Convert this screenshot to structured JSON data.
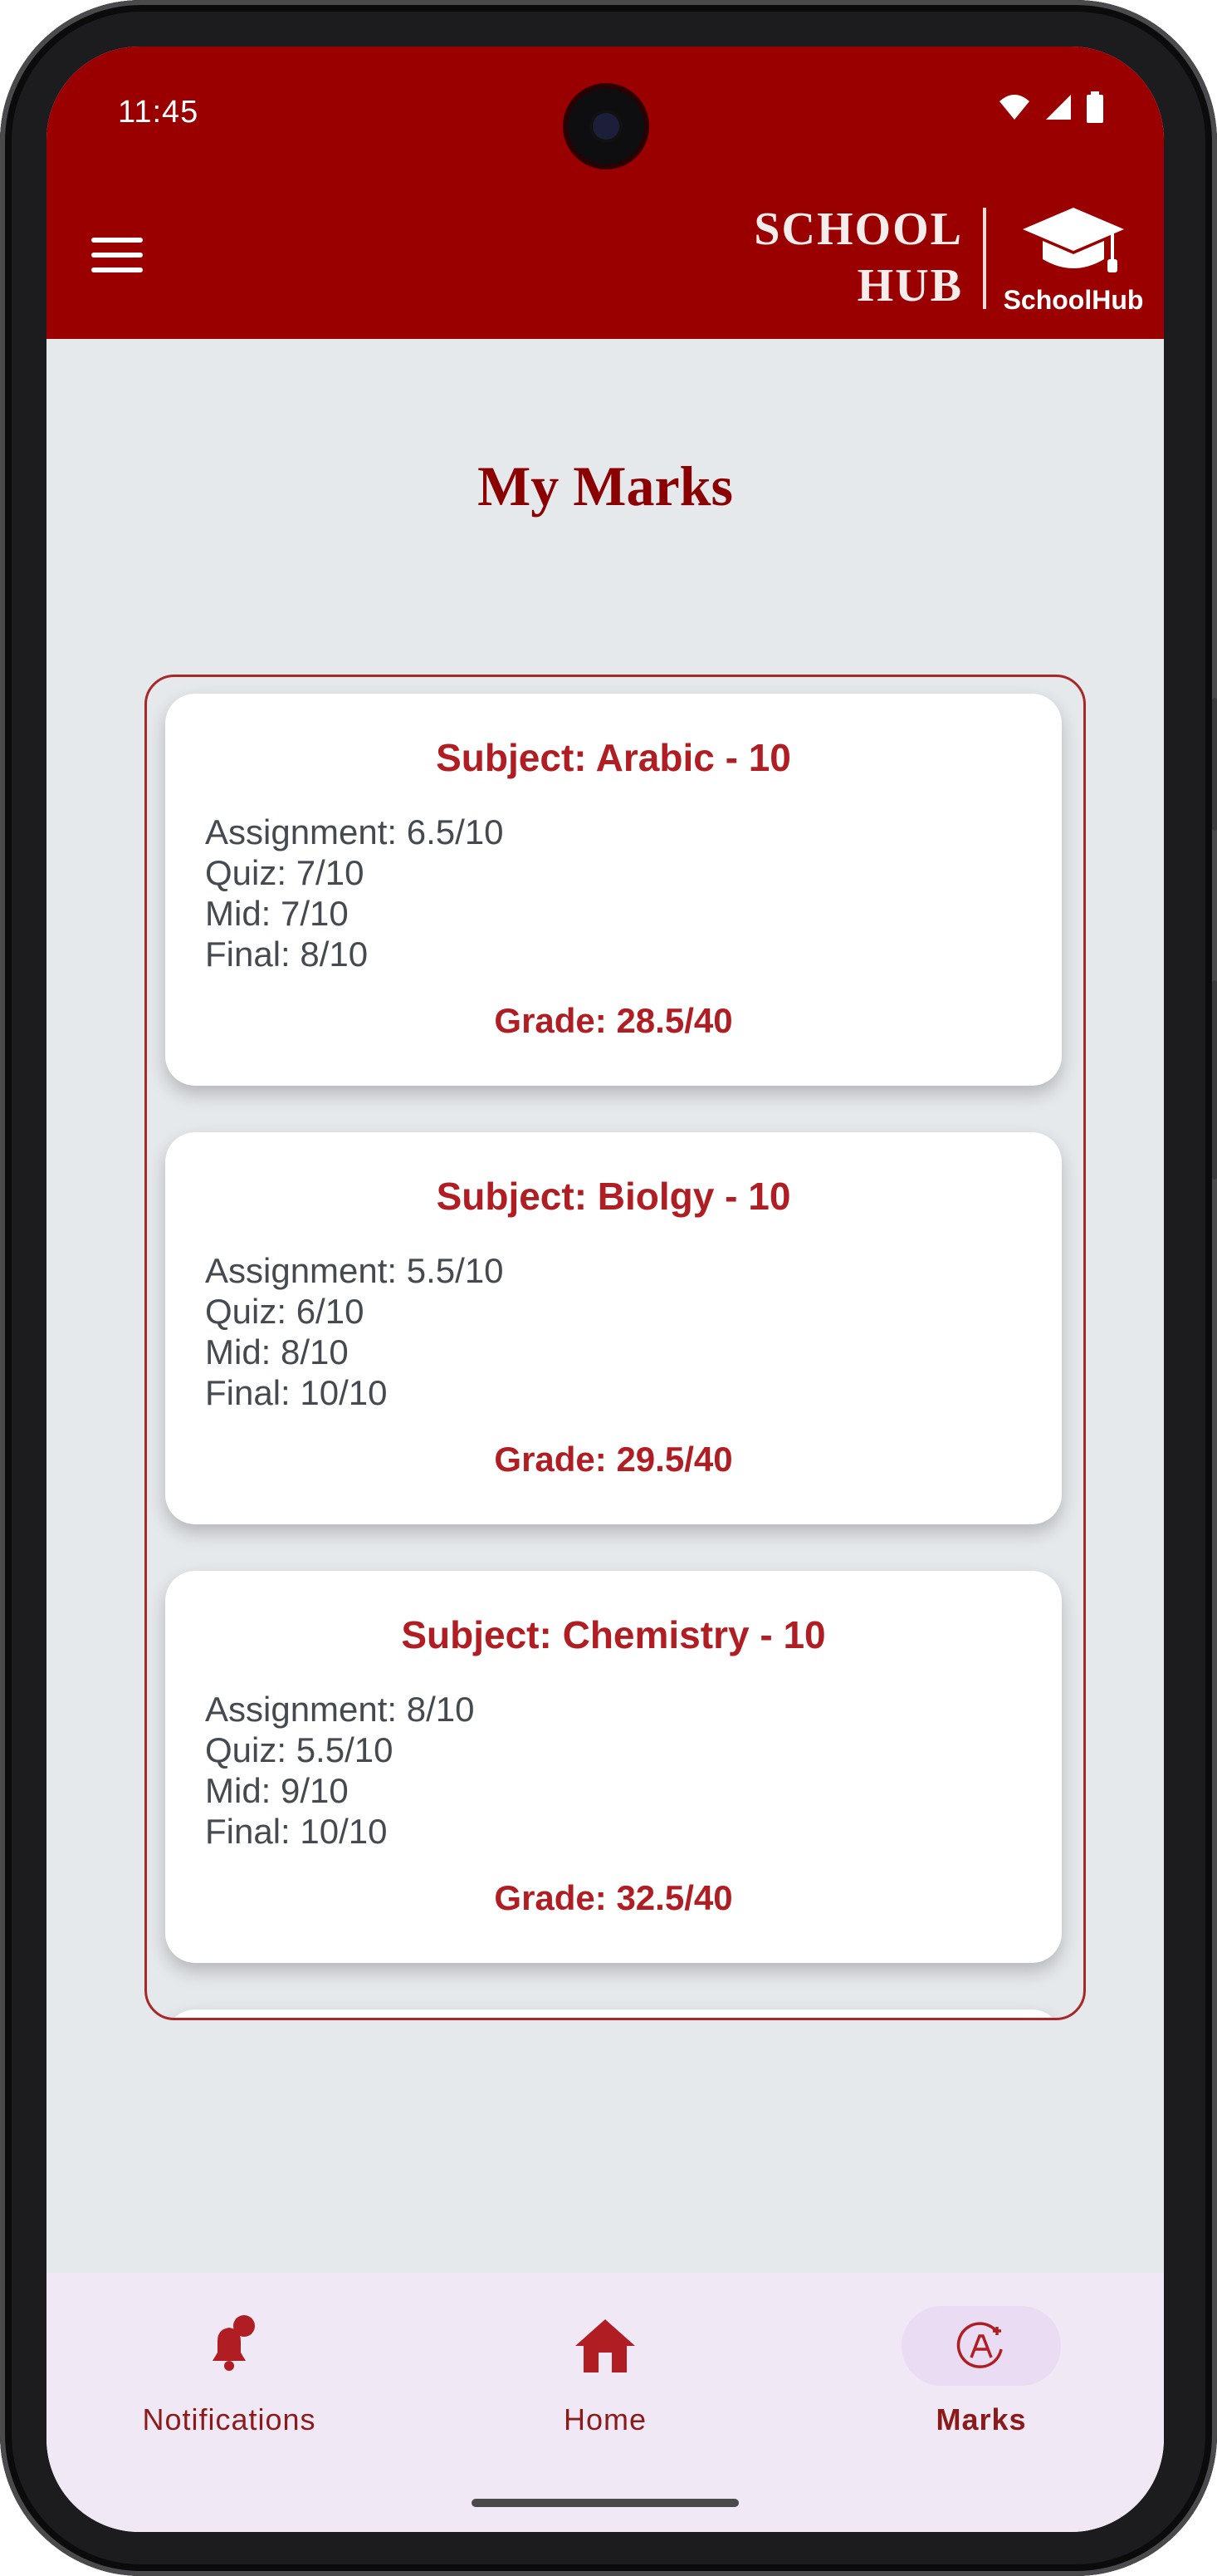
{
  "status_bar": {
    "time": "11:45"
  },
  "header": {
    "brand_line1": "SCHOOL",
    "brand_line2": "HUB",
    "logo_text": "SchoolHub"
  },
  "page": {
    "title": "My Marks"
  },
  "subjects": [
    {
      "subject": "Subject: Arabic - 10",
      "assignment": "Assignment: 6.5/10",
      "quiz": "Quiz: 7/10",
      "mid": "Mid: 7/10",
      "final": "Final: 8/10",
      "grade": "Grade: 28.5/40"
    },
    {
      "subject": "Subject: Biolgy - 10",
      "assignment": "Assignment: 5.5/10",
      "quiz": "Quiz: 6/10",
      "mid": "Mid: 8/10",
      "final": "Final: 10/10",
      "grade": "Grade: 29.5/40"
    },
    {
      "subject": "Subject: Chemistry - 10",
      "assignment": "Assignment: 8/10",
      "quiz": "Quiz: 5.5/10",
      "mid": "Mid: 9/10",
      "final": "Final: 10/10",
      "grade": "Grade: 32.5/40"
    }
  ],
  "bottom_nav": {
    "items": [
      {
        "label": "Notifications",
        "icon": "bell-badge-icon",
        "active": false
      },
      {
        "label": "Home",
        "icon": "home-icon",
        "active": false
      },
      {
        "label": "Marks",
        "icon": "grade-a-plus-icon",
        "active": true
      }
    ]
  },
  "colors": {
    "appbar": "#9b0000",
    "accent": "#b01e23",
    "nav_background": "#f1e8f5",
    "active_pill": "#e9dcf3"
  }
}
